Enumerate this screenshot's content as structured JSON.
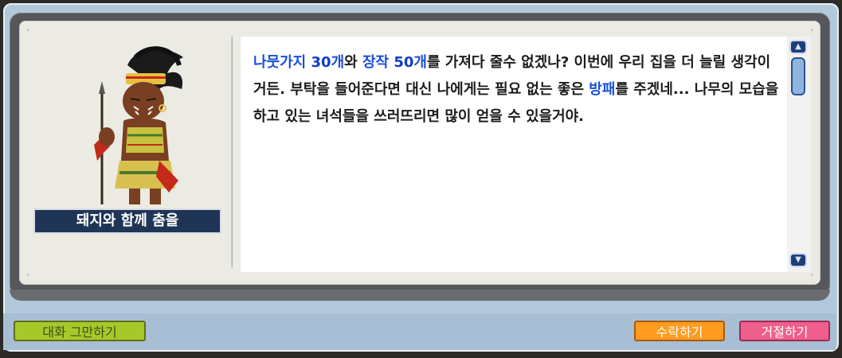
{
  "npc": {
    "name": "돼지와 함께 춤을"
  },
  "dialog": {
    "segments": [
      {
        "text": "나뭇가지 ",
        "style": "blue"
      },
      {
        "text": "30",
        "style": "blue-strong"
      },
      {
        "text": "개",
        "style": "blue"
      },
      {
        "text": "와 ",
        "style": "plain"
      },
      {
        "text": "장작 ",
        "style": "blue"
      },
      {
        "text": "50",
        "style": "blue-strong"
      },
      {
        "text": "개",
        "style": "blue"
      },
      {
        "text": "를 가져다 줄수 없겠나? 이번에 우리 집을 더 늘릴 생각이거든. 부탁을 들어준다면 대신 나에게는 필요 없는 좋은 ",
        "style": "plain"
      },
      {
        "text": "방패",
        "style": "blue"
      },
      {
        "text": "를 주겠네... 나무의 모습을 하고 있는 녀석들을 쓰러뜨리면 많이 얻을 수 있을거야.",
        "style": "plain"
      }
    ]
  },
  "buttons": {
    "end_chat": "대화 그만하기",
    "accept": "수락하기",
    "decline": "거절하기"
  },
  "icons": {
    "scroll_up": "scroll-up-arrow-icon",
    "scroll_down": "scroll-down-arrow-icon"
  },
  "colors": {
    "highlight_blue": "#1a4fd8",
    "end_button": "#a8c82a",
    "accept_button": "#ff9b1f",
    "decline_button": "#ef5f8c"
  }
}
